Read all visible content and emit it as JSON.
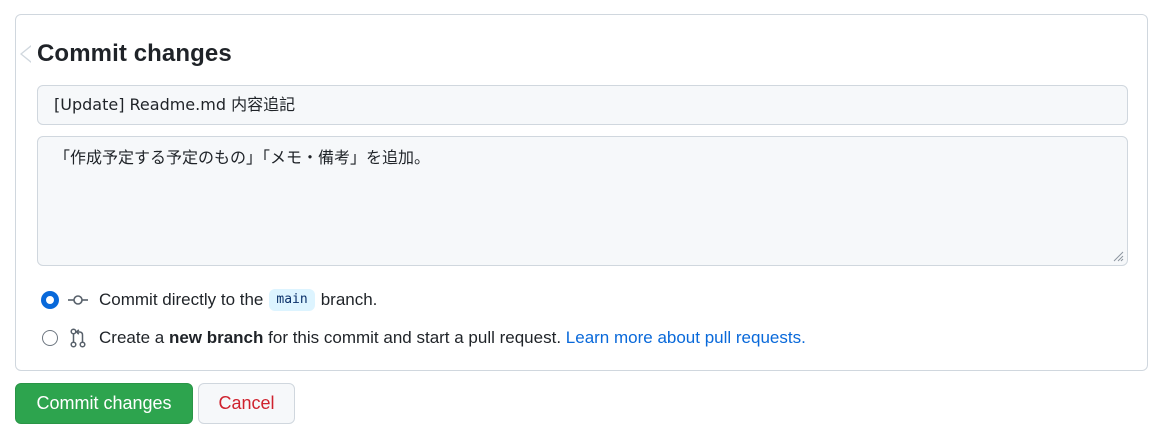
{
  "form": {
    "title": "Commit changes",
    "summary_value": "[Update] Readme.md  内容追記",
    "description_value": "「作成予定する予定のもの」「メモ・備考」を追加。"
  },
  "options": {
    "direct": {
      "prefix": "Commit directly to the",
      "branch": "main",
      "suffix": "branch.",
      "selected": true,
      "icon": "git-commit-icon"
    },
    "new_branch": {
      "prefix": "Create a",
      "bold": "new branch",
      "middle": "for this commit and start a pull request.",
      "link": "Learn more about pull requests.",
      "selected": false,
      "icon": "git-pull-request-icon"
    }
  },
  "buttons": {
    "commit_label": "Commit changes",
    "cancel_label": "Cancel"
  },
  "colors": {
    "primary": "#2da44e",
    "link": "#0969da",
    "danger": "#cf222e"
  }
}
